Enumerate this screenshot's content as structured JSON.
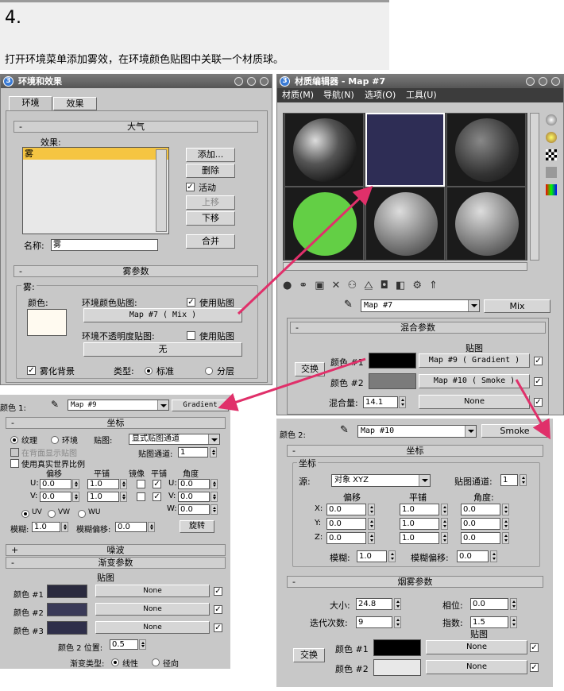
{
  "step": {
    "number": "4.",
    "instruction": "打开环境菜单添加雾效，在环境颜色贴图中关联一个材质球。"
  },
  "env_window": {
    "title": "环境和效果",
    "tabs": [
      "环境",
      "效果"
    ],
    "atmosphere": {
      "title": "大气",
      "effects_label": "效果:",
      "effect_item": "雾",
      "buttons": {
        "add": "添加...",
        "delete": "删除",
        "active": "活动",
        "move_up": "上移",
        "move_down": "下移",
        "merge": "合并"
      },
      "name_label": "名称:",
      "name_value": "雾"
    },
    "fog": {
      "title": "雾参数",
      "group": "雾:",
      "color_label": "颜色:",
      "env_color_map_label": "环境颜色贴图:",
      "use_map": "使用贴图",
      "env_color_map": "Map #7  ( Mix )",
      "env_opacity_map_label": "环境不透明度贴图:",
      "use_map2": "使用贴图",
      "env_opacity_map": "无",
      "fog_bg": "雾化背景",
      "type_label": "类型:",
      "type_std": "标准",
      "type_layer": "分层"
    }
  },
  "mat_editor": {
    "title": "材质编辑器 - Map #7",
    "menus": [
      "材质(M)",
      "导航(N)",
      "选项(O)",
      "工具(U)"
    ],
    "map_name": "Map #7",
    "map_type": "Mix",
    "mix_params": {
      "title": "混合参数",
      "map_header": "贴图",
      "swap": "交换",
      "color1_label": "颜色 #1",
      "color1_map": "Map #9  ( Gradient )",
      "color2_label": "颜色 #2",
      "color2_map": "Map #10  ( Smoke )",
      "mix_amount_label": "混合量:",
      "mix_amount": "14.1",
      "mix_map": "None"
    }
  },
  "gradient_panel": {
    "color_label": "颜色 1:",
    "map_name": "Map #9",
    "map_type": "Gradient",
    "coords": {
      "title": "坐标",
      "texture": "纹理",
      "environ": "环境",
      "mapping_label": "贴图:",
      "mapping": "显式贴图通道",
      "show_back": "在背面显示贴图",
      "channel_label": "贴图通道:",
      "channel": "1",
      "real_world": "使用真实世界比例",
      "col_offset": "偏移",
      "col_tiling": "平铺",
      "col_mirror": "镜像",
      "col_tile": "平铺",
      "col_angle": "角度",
      "u_offset": "0.0",
      "u_tiling": "1.0",
      "v_offset": "0.0",
      "v_tiling": "1.0",
      "u_angle": "0.0",
      "v_angle": "0.0",
      "w_angle": "0.0",
      "uv": "UV",
      "vw": "VW",
      "wu": "WU",
      "blur_label": "模糊:",
      "blur": "1.0",
      "blur_offset_label": "模糊偏移:",
      "blur_offset": "0.0",
      "rotate": "旋转"
    },
    "noise_title": "噪波",
    "grad_params": {
      "title": "渐变参数",
      "map_header": "贴图",
      "colors": [
        {
          "label": "颜色 #1",
          "map": "None",
          "swatch": "#2a2a3e"
        },
        {
          "label": "颜色 #2",
          "map": "None",
          "swatch": "#3a3a58"
        },
        {
          "label": "颜色 #3",
          "map": "None",
          "swatch": "#2f2f4a"
        }
      ],
      "pos_label": "颜色 2 位置:",
      "pos": "0.5",
      "type_label": "渐变类型:",
      "linear": "线性",
      "radial": "径向"
    }
  },
  "smoke_panel": {
    "color_label": "颜色 2:",
    "map_name": "Map #10",
    "map_type": "Smoke",
    "coords": {
      "title": "坐标",
      "group": "坐标",
      "source_label": "源:",
      "source": "对象 XYZ",
      "channel_label": "贴图通道:",
      "channel": "1",
      "col_offset": "偏移",
      "col_tiling": "平铺",
      "col_angle": "角度:",
      "rows": [
        {
          "axis": "X:",
          "offset": "0.0",
          "tiling": "1.0",
          "angle": "0.0"
        },
        {
          "axis": "Y:",
          "offset": "0.0",
          "tiling": "1.0",
          "angle": "0.0"
        },
        {
          "axis": "Z:",
          "offset": "0.0",
          "tiling": "1.0",
          "angle": "0.0"
        }
      ],
      "blur_label": "模糊:",
      "blur": "1.0",
      "blur_offset_label": "模糊偏移:",
      "blur_offset": "0.0"
    },
    "smoke_params": {
      "title": "烟雾参数",
      "size_label": "大小:",
      "size": "24.8",
      "phase_label": "相位:",
      "phase": "0.0",
      "iter_label": "迭代次数:",
      "iter": "9",
      "exp_label": "指数:",
      "exp": "1.5",
      "map_header": "贴图",
      "swap": "交换",
      "color1_label": "颜色 #1",
      "color1_map": "None",
      "color2_label": "颜色 #2",
      "color2_map": "None"
    }
  },
  "colors": {
    "arrow": "#e0306a",
    "win_bg": "#c8c8c8",
    "selected_item": "#f5c542",
    "fog_color": "#fffaf0"
  }
}
